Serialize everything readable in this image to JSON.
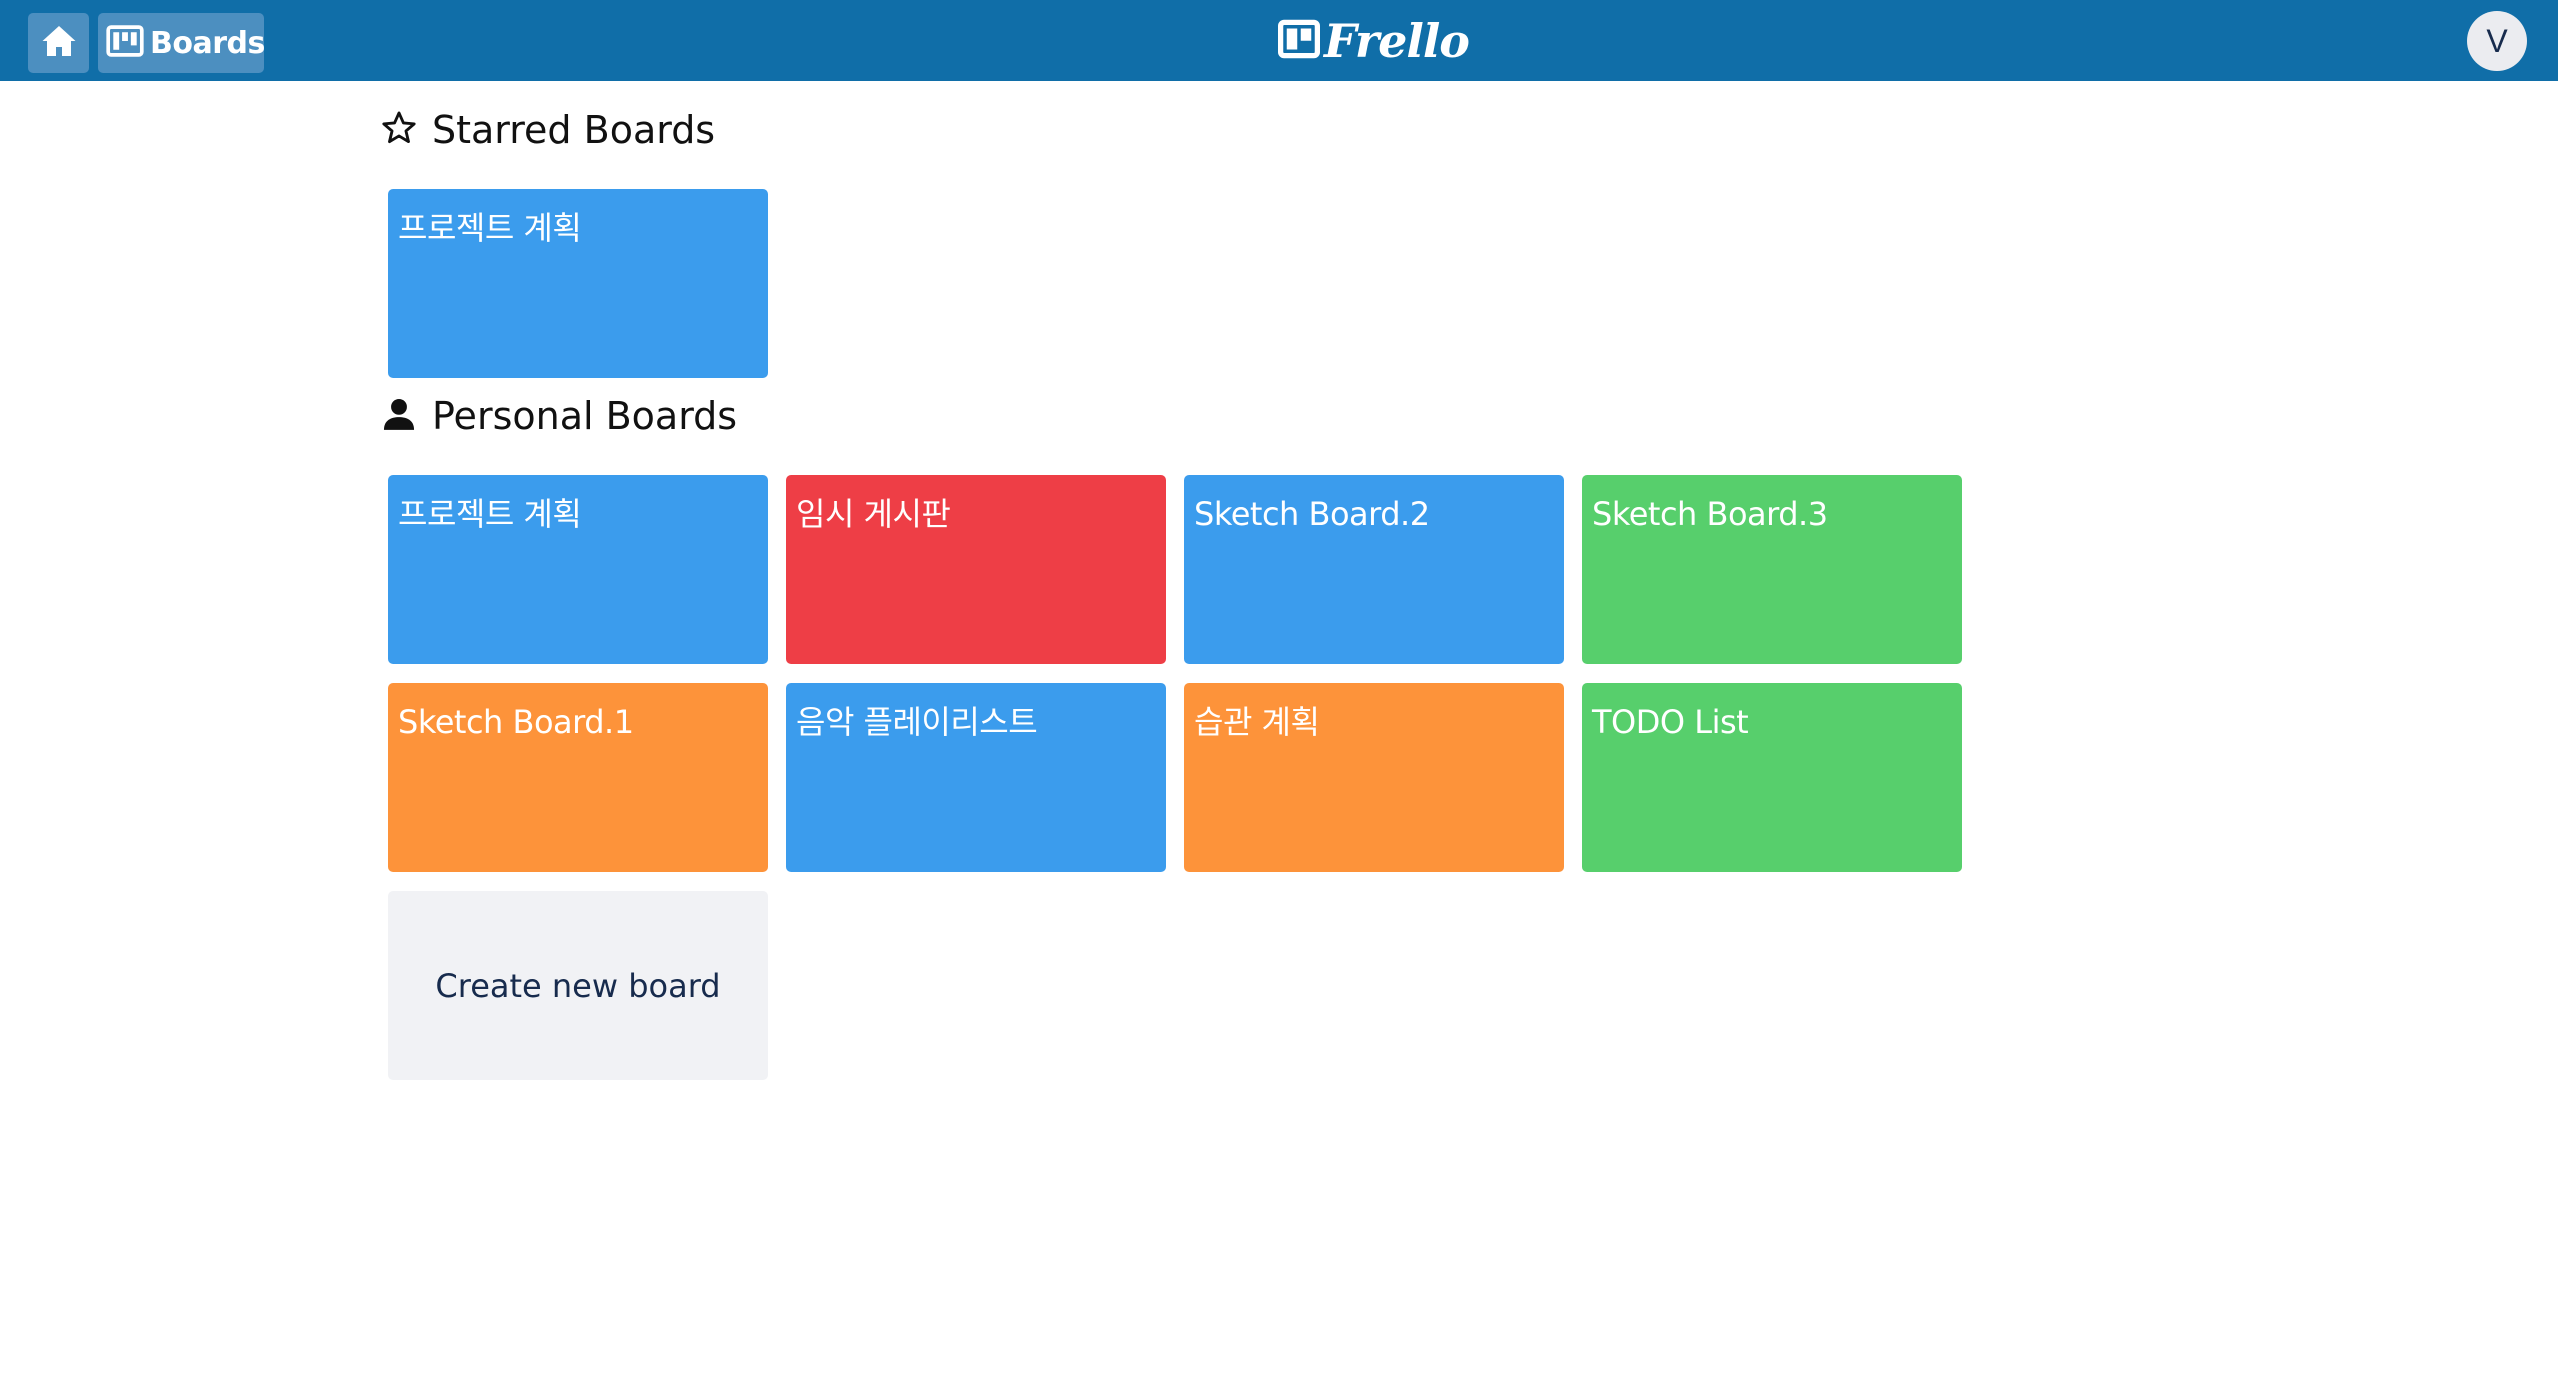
{
  "header": {
    "boards_label": "Boards",
    "logo_text": "Frello",
    "avatar_initial": "V",
    "bar_color": "#106ea8",
    "button_color": "#4c8fc0",
    "icons": {
      "home": "home-icon",
      "boards": "boards-icon",
      "logo": "trello-board-icon"
    }
  },
  "starred": {
    "heading": "Starred Boards",
    "icon": "star-outline-icon",
    "boards": [
      {
        "name": "프로젝트 계획",
        "color": "#3b9ced"
      }
    ]
  },
  "personal": {
    "heading": "Personal Boards",
    "icon": "person-icon",
    "boards": [
      {
        "name": "프로젝트 계획",
        "color": "#3b9ced"
      },
      {
        "name": "임시 게시판",
        "color": "#ee3e46"
      },
      {
        "name": "Sketch Board.2",
        "color": "#3b9ced"
      },
      {
        "name": "Sketch Board.3",
        "color": "#57cf6c"
      },
      {
        "name": "Sketch Board.1",
        "color": "#fd933a"
      },
      {
        "name": "음악 플레이리스트",
        "color": "#3b9ced"
      },
      {
        "name": "습관 계획",
        "color": "#fd933a"
      },
      {
        "name": "TODO List",
        "color": "#57cf6c"
      }
    ],
    "create_label": "Create new board"
  }
}
